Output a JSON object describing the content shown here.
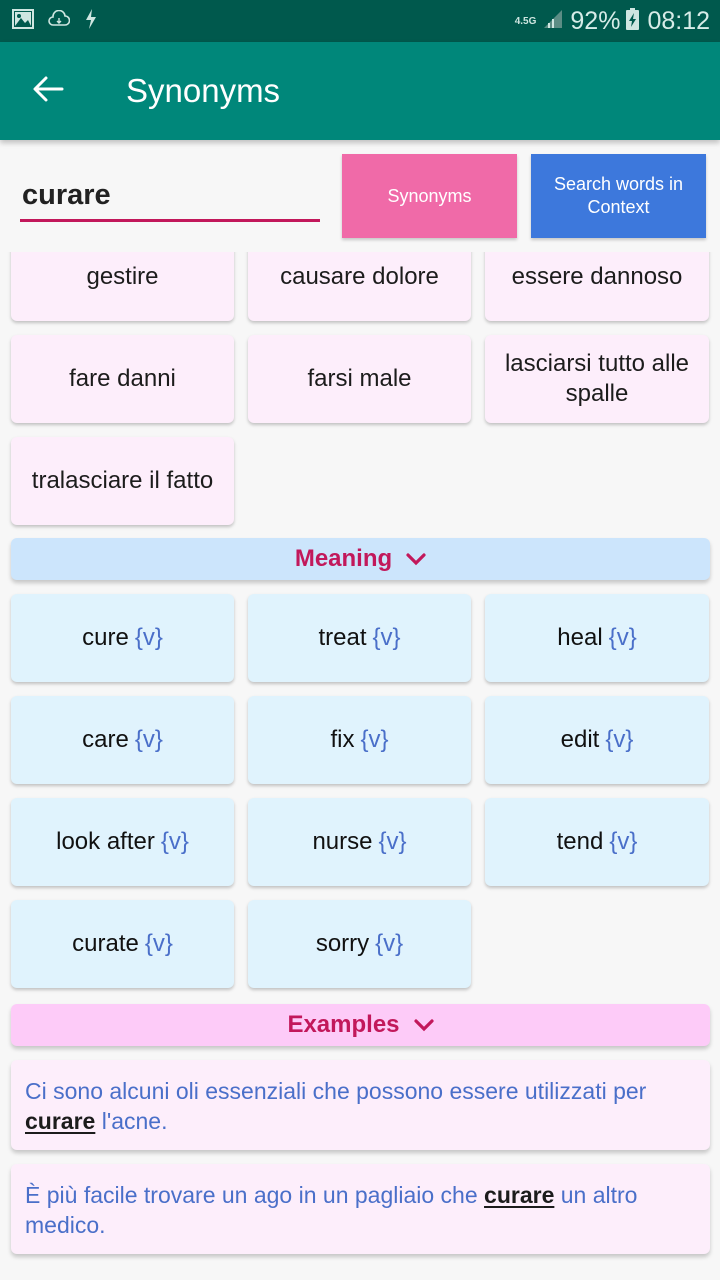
{
  "status_bar": {
    "left_icons": [
      "image-icon",
      "cloud-sync-icon",
      "flash-icon"
    ],
    "network": "4.5G",
    "battery_percent": "92%",
    "time": "08:12"
  },
  "app_bar": {
    "title": "Synonyms",
    "back_icon": "arrow-left-icon"
  },
  "search": {
    "value": "curare",
    "synonyms_button": "Synonyms",
    "context_button": "Search words in Context"
  },
  "synonyms": [
    {
      "text": "gestire"
    },
    {
      "text": "causare dolore"
    },
    {
      "text": "essere dannoso"
    },
    {
      "text": "fare danni"
    },
    {
      "text": "farsi male"
    },
    {
      "text": "lasciarsi tutto alle spalle"
    },
    {
      "text": "tralasciare il fatto"
    }
  ],
  "meaning": {
    "header": "Meaning",
    "items": [
      {
        "word": "cure",
        "pos": "{v}"
      },
      {
        "word": "treat",
        "pos": "{v}"
      },
      {
        "word": "heal",
        "pos": "{v}"
      },
      {
        "word": "care",
        "pos": "{v}"
      },
      {
        "word": "fix",
        "pos": "{v}"
      },
      {
        "word": "edit",
        "pos": "{v}"
      },
      {
        "word": "look after",
        "pos": "{v}"
      },
      {
        "word": "nurse",
        "pos": "{v}"
      },
      {
        "word": "tend",
        "pos": "{v}"
      },
      {
        "word": "curate",
        "pos": "{v}"
      },
      {
        "word": "sorry",
        "pos": "{v}"
      }
    ]
  },
  "examples": {
    "header": "Examples",
    "items": [
      {
        "before": "Ci sono alcuni oli essenziali che possono essere utilizzati per ",
        "highlight": "curare",
        "after": " l'acne."
      },
      {
        "before": "È più facile trovare un ago in un pagliaio che ",
        "highlight": "curare",
        "after": " un altro medico."
      }
    ]
  },
  "colors": {
    "status_bar": "#00594d",
    "app_bar": "#00877a",
    "accent": "#c2185b",
    "synonyms_button": "#f06aa8",
    "context_button": "#3d78dc",
    "pos_tag": "#4a6fc9"
  }
}
